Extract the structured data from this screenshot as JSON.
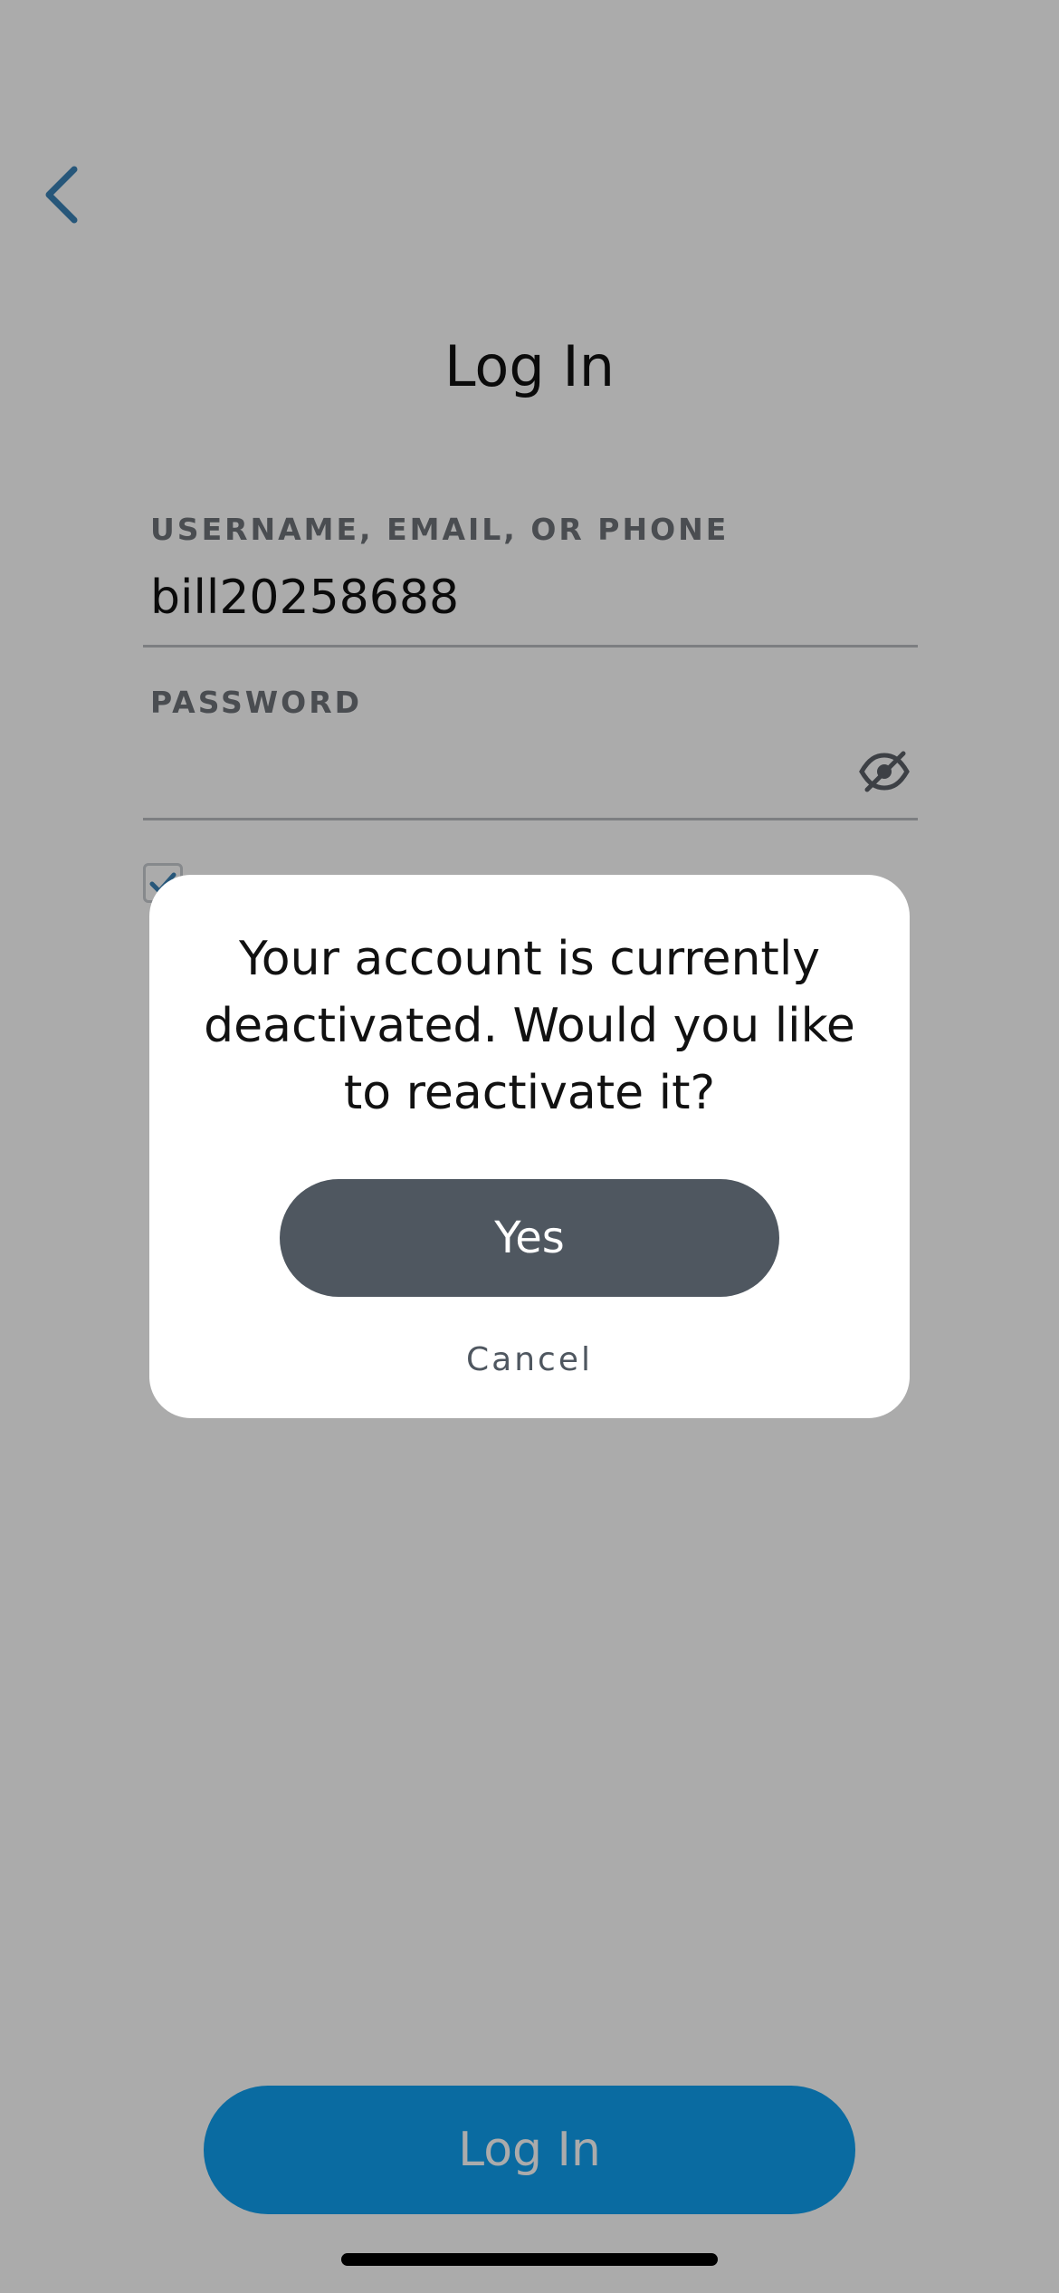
{
  "login_screen": {
    "title": "Log In",
    "username_field": {
      "label": "USERNAME, EMAIL, OR PHONE",
      "value": "bill20258688"
    },
    "password_field": {
      "label": "PASSWORD",
      "value": ""
    },
    "remember_checkbox": {
      "checked": true
    },
    "login_button_label": "Log In"
  },
  "dialog": {
    "message": "Your account is currently deactivated. Would you like to reactivate it?",
    "yes_label": "Yes",
    "cancel_label": "Cancel"
  },
  "icons": {
    "back": "chevron-left-icon",
    "password_visibility": "eye-slash-icon",
    "checkbox": "checkmark-icon"
  },
  "colors": {
    "accent": "#0fa0f0",
    "back_chevron": "#3b82b6",
    "dialog_primary_button": "#4f5760",
    "label_gray": "#6f737a"
  }
}
